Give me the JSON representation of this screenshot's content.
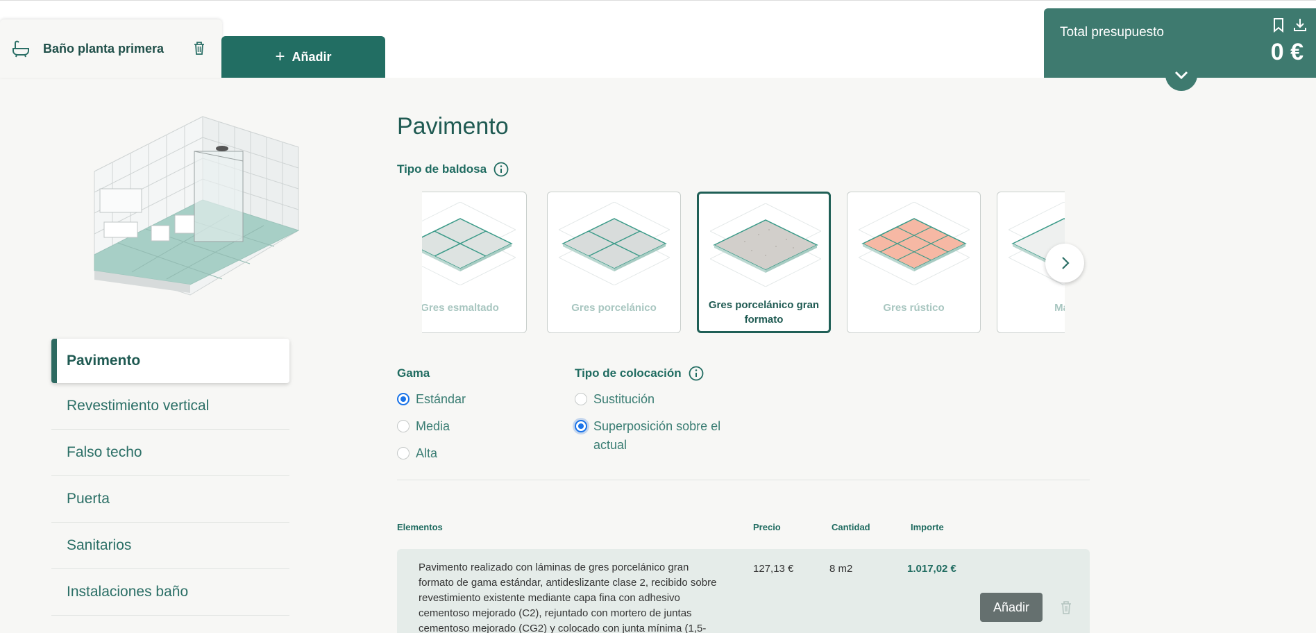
{
  "header": {
    "room_name": "Baño planta primera",
    "add_label": "Añadir",
    "budget_label": "Total presupuesto",
    "budget_amount": "0 €"
  },
  "sidebar": {
    "items": [
      {
        "label": "Pavimento",
        "active": true
      },
      {
        "label": "Revestimiento vertical"
      },
      {
        "label": "Falso techo"
      },
      {
        "label": "Puerta"
      },
      {
        "label": "Sanitarios"
      },
      {
        "label": "Instalaciones baño"
      }
    ]
  },
  "main": {
    "title": "Pavimento",
    "tile_type_label": "Tipo de baldosa",
    "tiles": [
      {
        "label": "Gres esmaltado"
      },
      {
        "label": "Gres porcelánico"
      },
      {
        "label": "Gres porcelánico gran formato",
        "selected": true
      },
      {
        "label": "Gres rústico"
      },
      {
        "label": "Már"
      }
    ],
    "gama": {
      "label": "Gama",
      "options": [
        "Estándar",
        "Media",
        "Alta"
      ],
      "selected": "Estándar"
    },
    "colocacion": {
      "label": "Tipo de colocación",
      "options": [
        "Sustitución",
        "Superposición sobre el actual"
      ],
      "selected": "Superposición sobre el actual"
    },
    "table": {
      "headers": {
        "elements": "Elementos",
        "price": "Precio",
        "qty": "Cantidad",
        "amount": "Importe"
      },
      "rows": [
        {
          "description": "Pavimento realizado con láminas de gres porcelánico gran formato de gama estándar, antideslizante clase 2, recibido sobre revestimiento existente mediante capa fina con adhesivo cementoso mejorado (C2), rejuntado con mortero de juntas cementoso mejorado (CG2) y colocado con junta mínima (1,5-",
          "price": "127,13 €",
          "qty": "8 m2",
          "amount": "1.017,02 €",
          "add_label": "Añadir"
        }
      ]
    }
  },
  "colors": {
    "brand": "#226e63",
    "budget_bg": "#3e7a6f",
    "radio_checked": "#1a73e8",
    "row_bg": "#e5ece9"
  }
}
